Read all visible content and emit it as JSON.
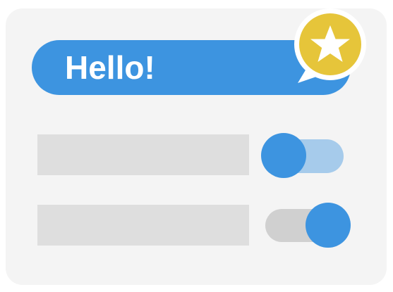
{
  "greeting": "Hello!",
  "colors": {
    "primary": "#3d94e0",
    "primary_light": "#a6cbeb",
    "off_track": "#d0d0d0",
    "badge": "#e6c53a",
    "card": "#f4f4f4",
    "placeholder": "#dedede"
  },
  "toggles": [
    {
      "state": "off"
    },
    {
      "state": "on"
    }
  ],
  "badge_icon": "star-icon"
}
